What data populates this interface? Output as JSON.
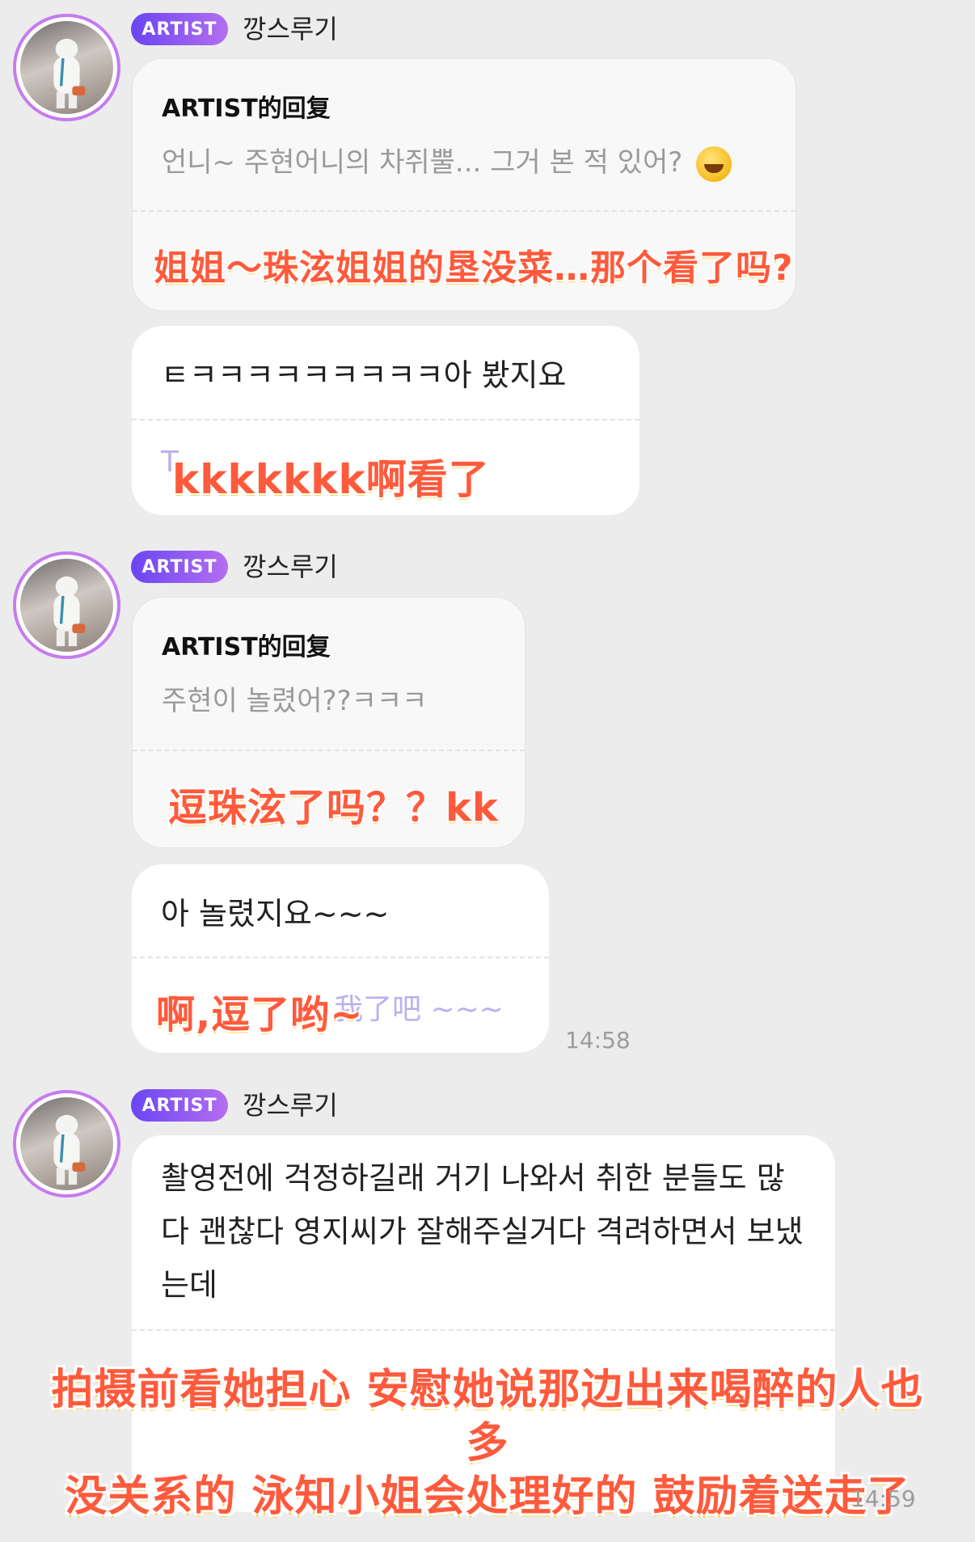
{
  "groups": [
    {
      "badge": "ARTIST",
      "sender": "깡스루기"
    },
    {
      "badge": "ARTIST",
      "sender": "깡스루기"
    },
    {
      "badge": "ARTIST",
      "sender": "깡스루기"
    }
  ],
  "msg1": {
    "reply_title": "ARTIST的回复",
    "quote": "언니~ 주현어니의 차쥐뿔... 그거 본 적 있어?",
    "translation": "姐姐～珠泫姐姐的垦没菜…那个看了吗?"
  },
  "msg2": {
    "text": "ㅌㅋㅋㅋㅋㅋㅋㅋㅋㅋ아 봤지요",
    "translation": "kkkkkkk啊看了",
    "ghost": "T"
  },
  "msg3": {
    "reply_title": "ARTIST的回复",
    "quote": "주현이 놀렸어??ㅋㅋㅋ",
    "translation": "逗珠泫了吗？？kk"
  },
  "msg4": {
    "text": "아 놀렸지요~~~",
    "translation": "啊,逗了哟~",
    "ghost": "我了吧 ~~~",
    "time": "14:58"
  },
  "msg5": {
    "text": "촬영전에 걱정하길래 거기 나와서 취한 분들도 많다 괜찮다 영지씨가 잘해주실거다 격려하면서 보냈는데",
    "subtitle_line1": "拍摄前看她担心 安慰她说那边出来喝醉的人也多",
    "subtitle_line2": "没关系的 泳知小姐会处理好的 鼓励着送走了",
    "time": "14:59"
  }
}
